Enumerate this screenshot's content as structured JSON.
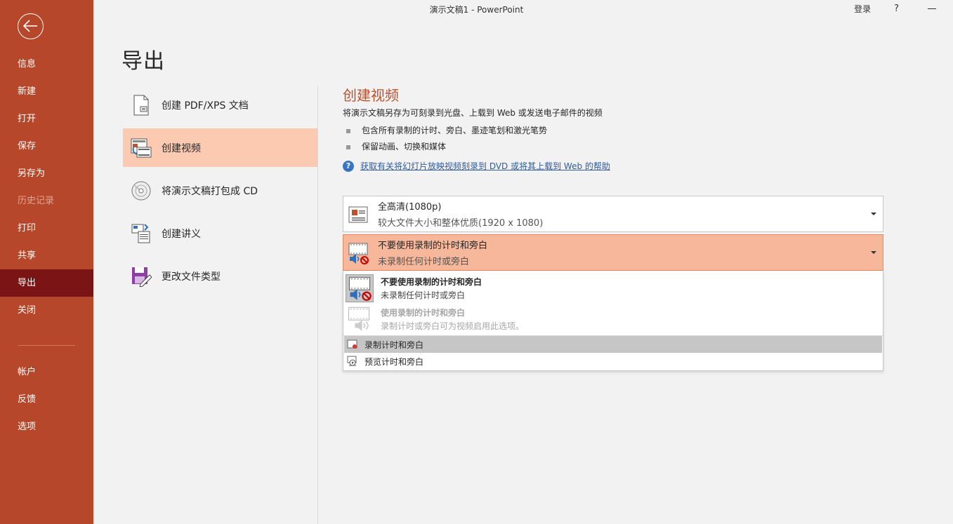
{
  "window": {
    "title": "演示文稿1  -  PowerPoint",
    "login": "登录",
    "help": "?"
  },
  "sidebar": {
    "items": [
      {
        "label": "信息"
      },
      {
        "label": "新建"
      },
      {
        "label": "打开"
      },
      {
        "label": "保存"
      },
      {
        "label": "另存为"
      },
      {
        "label": "历史记录"
      },
      {
        "label": "打印"
      },
      {
        "label": "共享"
      },
      {
        "label": "导出"
      },
      {
        "label": "关闭"
      }
    ],
    "bottom_items": [
      {
        "label": "帐户"
      },
      {
        "label": "反馈"
      },
      {
        "label": "选项"
      }
    ],
    "colors": {
      "background": "#b7472a",
      "active": "#7b1414"
    }
  },
  "page": {
    "title": "导出"
  },
  "export_options": [
    {
      "label": "创建 PDF/XPS 文档",
      "icon": "pdf-document-icon"
    },
    {
      "label": "创建视频",
      "icon": "create-video-icon"
    },
    {
      "label": "将演示文稿打包成 CD",
      "icon": "cd-icon"
    },
    {
      "label": "创建讲义",
      "icon": "handout-icon"
    },
    {
      "label": "更改文件类型",
      "icon": "save-as-type-icon"
    }
  ],
  "detail": {
    "title": "创建视频",
    "description": "将演示文稿另存为可刻录到光盘、上载到 Web 或发送电子邮件的视频",
    "bullets": [
      "包含所有录制的计时、旁白、墨迹笔划和激光笔势",
      "保留动画、切换和媒体"
    ],
    "help_link": "获取有关将幻灯片放映视频刻录到 DVD 或将其上载到 Web 的帮助",
    "quality_select": {
      "line1": "全高清(1080p)",
      "line2": "较大文件大小和整体优质(1920 x 1080)"
    },
    "timing_select": {
      "line1": "不要使用录制的计时和旁白",
      "line2": "未录制任何计时或旁白"
    },
    "timing_dropdown": {
      "options": [
        {
          "line1": "不要使用录制的计时和旁白",
          "line2": "未录制任何计时或旁白"
        },
        {
          "line1": "使用录制的计时和旁白",
          "line2": "录制计时或旁白可为视频启用此选项。"
        }
      ],
      "actions": [
        {
          "label": "录制计时和旁白"
        },
        {
          "label": "预览计时和旁白"
        }
      ]
    },
    "accent_color": "#c0502b"
  }
}
